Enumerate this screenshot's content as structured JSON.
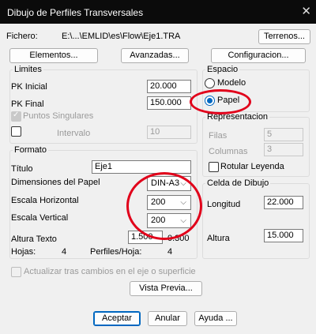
{
  "window": {
    "title": "Dibujo de Perfiles Transversales",
    "close_glyph": "✕"
  },
  "file": {
    "label": "Fichero:",
    "path": "E:\\...\\EMLID\\es\\Flow\\Eje1.TRA",
    "terrenos_button": "Terrenos..."
  },
  "toolbar": {
    "elementos": "Elementos...",
    "avanzadas": "Avanzadas...",
    "configuracion": "Configuracion..."
  },
  "limites": {
    "title": "Limites",
    "pk_inicial_label": "PK Inicial",
    "pk_inicial_value": "20.000",
    "pk_final_label": "PK Final",
    "pk_final_value": "150.000",
    "puntos_singulares": "Puntos Singulares",
    "intervalo_label": "Intervalo",
    "intervalo_value": "10"
  },
  "espacio": {
    "title": "Espacio",
    "modelo": "Modelo",
    "papel": "Papel",
    "selected": "Papel"
  },
  "representacion": {
    "title": "Representacion",
    "filas_label": "Filas",
    "filas_value": "5",
    "columnas_label": "Columnas",
    "columnas_value": "3",
    "rotular_leyenda": "Rotular Leyenda"
  },
  "formato": {
    "title": "Formato",
    "titulo_label": "Título",
    "titulo_value": "Eje1",
    "dimensiones_label": "Dimensiones del Papel",
    "dimensiones_value": "DIN-A3",
    "escala_h_label": "Escala Horizontal",
    "escala_h_value": "200",
    "escala_v_label": "Escala Vertical",
    "escala_v_value": "200",
    "altura_texto_label": "Altura Texto",
    "altura_texto_value": "1.500",
    "altura_texto_extra": "0.300",
    "hojas_label": "Hojas:",
    "hojas_value": "4",
    "perfiles_label": "Perfiles/Hoja:",
    "perfiles_value": "4"
  },
  "celda": {
    "title": "Celda de Dibujo",
    "longitud_label": "Longitud",
    "longitud_value": "22.000",
    "altura_label": "Altura",
    "altura_value": "15.000"
  },
  "actualizar": "Actualizar tras cambios en el eje o superficie",
  "vista_previa": "Vista Previa...",
  "footer": {
    "aceptar": "Aceptar",
    "anular": "Anular",
    "ayuda": "Ayuda ..."
  },
  "colors": {
    "titlebar": "#0b0b0b",
    "annotation": "#e1001a",
    "accent": "#0067c0"
  }
}
